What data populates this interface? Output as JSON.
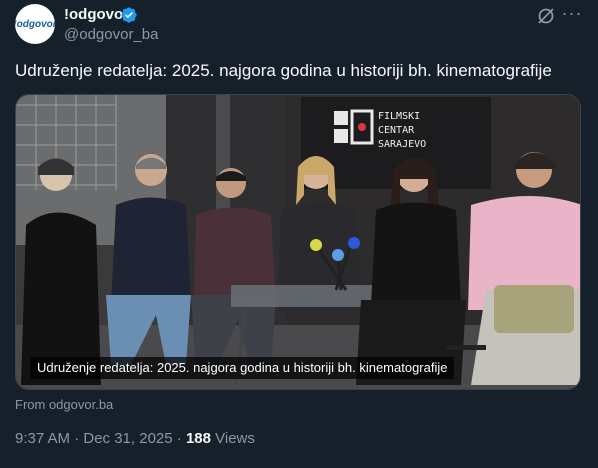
{
  "author": {
    "name": "!odgovor",
    "handle": "@odgovor_ba",
    "avatar_text": "!odgovor",
    "verified": true
  },
  "icons": [
    "verified-badge-icon",
    "grok-icon",
    "more-icon"
  ],
  "tweet": {
    "text": "Udruženje redatelja: 2025. najgora godina u historiji bh. kinematografije"
  },
  "media": {
    "caption": "Udruženje redatelja: 2025. najgora godina u historiji bh. kinematografije",
    "sign_line1": "FILMSKI",
    "sign_line2": "CENTAR",
    "sign_line3": "SARAJEVO"
  },
  "source": {
    "text": "From odgovor.ba"
  },
  "meta": {
    "time": "9:37 AM · Dec 31, 2025 · ",
    "views_count": "188",
    "views_label": " Views"
  },
  "colors": {
    "background": "#15202b",
    "text": "#f7f9f9",
    "secondary": "#8b98a5",
    "verified": "#1d9bf0"
  }
}
